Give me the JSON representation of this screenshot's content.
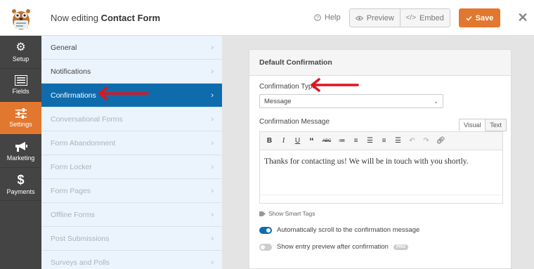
{
  "header": {
    "editing_prefix": "Now editing",
    "form_name": "Contact Form",
    "help_label": "Help",
    "preview_label": "Preview",
    "embed_label": "Embed",
    "save_label": "Save"
  },
  "leftnav": {
    "items": [
      {
        "label": "Setup",
        "icon": "gear-icon",
        "active": false
      },
      {
        "label": "Fields",
        "icon": "fields-list-icon",
        "active": false
      },
      {
        "label": "Settings",
        "icon": "sliders-icon",
        "active": true
      },
      {
        "label": "Marketing",
        "icon": "megaphone-icon",
        "active": false
      },
      {
        "label": "Payments",
        "icon": "dollar-icon",
        "active": false
      }
    ]
  },
  "settings_panel": {
    "items": [
      {
        "label": "General",
        "state": "normal"
      },
      {
        "label": "Notifications",
        "state": "normal"
      },
      {
        "label": "Confirmations",
        "state": "active"
      },
      {
        "label": "Conversational Forms",
        "state": "disabled"
      },
      {
        "label": "Form Abandonment",
        "state": "disabled"
      },
      {
        "label": "Form Locker",
        "state": "disabled"
      },
      {
        "label": "Form Pages",
        "state": "disabled"
      },
      {
        "label": "Offline Forms",
        "state": "disabled"
      },
      {
        "label": "Post Submissions",
        "state": "disabled"
      },
      {
        "label": "Surveys and Polls",
        "state": "disabled"
      }
    ]
  },
  "confirmation": {
    "card_title": "Default Confirmation",
    "type_label": "Confirmation Type",
    "type_value": "Message",
    "message_label": "Confirmation Message",
    "tab_visual": "Visual",
    "tab_text": "Text",
    "message_body": "Thanks for contacting us! We will be in touch with you shortly.",
    "smart_tags_label": "Show Smart Tags",
    "toggle_scroll_label": "Automatically scroll to the confirmation message",
    "toggle_scroll_on": true,
    "toggle_preview_label": "Show entry preview after confirmation",
    "toggle_preview_on": false,
    "pro_badge": "PRO"
  },
  "colors": {
    "accent_orange": "#e27730",
    "active_blue": "#0e6cad",
    "annotation_red": "#e0141e"
  }
}
